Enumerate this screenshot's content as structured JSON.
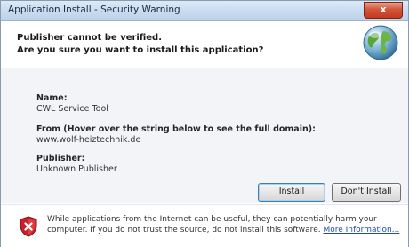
{
  "window": {
    "title": "Application Install - Security Warning",
    "close_label": "x"
  },
  "header": {
    "line1": "Publisher cannot be verified.",
    "line2": "Are you sure you want to install this application?"
  },
  "details": {
    "name_label": "Name:",
    "name_value": "CWL Service Tool",
    "from_label": "From (Hover over the string below to see the full domain):",
    "from_value": "www.wolf-heiztechnik.de",
    "publisher_label": "Publisher:",
    "publisher_value": "Unknown Publisher"
  },
  "buttons": {
    "install": "Install",
    "dont_install": "Don't Install"
  },
  "footer": {
    "warning_text": "While applications from the Internet can be useful, they can potentially harm your computer. If you do not trust the source, do not install this software. ",
    "more_link": "More Information..."
  },
  "icons": {
    "globe": "globe-icon",
    "shield": "security-shield-icon"
  },
  "colors": {
    "accent": "#3c7fb1",
    "link": "#1d4fb0",
    "shield_red": "#c8202a"
  }
}
